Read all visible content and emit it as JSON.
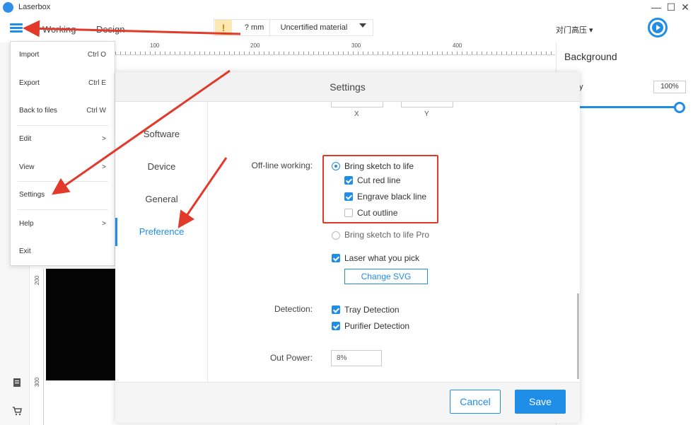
{
  "app": {
    "title": "Laserbox"
  },
  "window_controls": {
    "minimize": "—",
    "maximize": "☐",
    "close": "✕"
  },
  "toolbar": {
    "tabs": [
      "Working",
      "Design"
    ],
    "mm_value": "? mm",
    "material": "Uncertified material",
    "device_label": "对门高压 ▾"
  },
  "ruler": {
    "h_ticks": [
      "100",
      "200",
      "300",
      "400"
    ],
    "v_ticks": [
      "200",
      "300"
    ]
  },
  "right_panel": {
    "title": "Background",
    "opacity_label": "city",
    "opacity_value": "100%",
    "opacity_fraction": 1.0
  },
  "menu": {
    "items": [
      {
        "label": "Import",
        "shortcut": "Ctrl O"
      },
      {
        "label": "Export",
        "shortcut": "Ctrl E"
      },
      {
        "label": "Back to files",
        "shortcut": "Ctrl W"
      },
      {
        "label": "Edit",
        "shortcut": ">"
      },
      {
        "label": "View",
        "shortcut": ">"
      },
      {
        "label": "Settings",
        "shortcut": ""
      },
      {
        "label": "Help",
        "shortcut": ">"
      },
      {
        "label": "Exit",
        "shortcut": ""
      }
    ]
  },
  "dialog": {
    "title": "Settings",
    "nav": [
      "Software",
      "Device",
      "General",
      "Preference"
    ],
    "active_nav": "Preference",
    "x_label": "X",
    "y_label": "Y",
    "offline_label": "Off-line working:",
    "offline_options": {
      "bring_sketch": "Bring sketch to life",
      "cut_red": "Cut red line",
      "engrave_black": "Engrave black line",
      "cut_outline": "Cut outline",
      "bring_sketch_pro": "Bring sketch to life Pro",
      "laser_pick": "Laser what you pick"
    },
    "change_svg": "Change SVG",
    "detection_label": "Detection:",
    "tray_detection": "Tray Detection",
    "purifier_detection": "Purifier Detection",
    "out_power_label": "Out Power:",
    "out_power_value": "8%",
    "cancel": "Cancel",
    "save": "Save"
  },
  "colors": {
    "accent": "#1f8ee8",
    "annotation": "#e23a2a"
  }
}
